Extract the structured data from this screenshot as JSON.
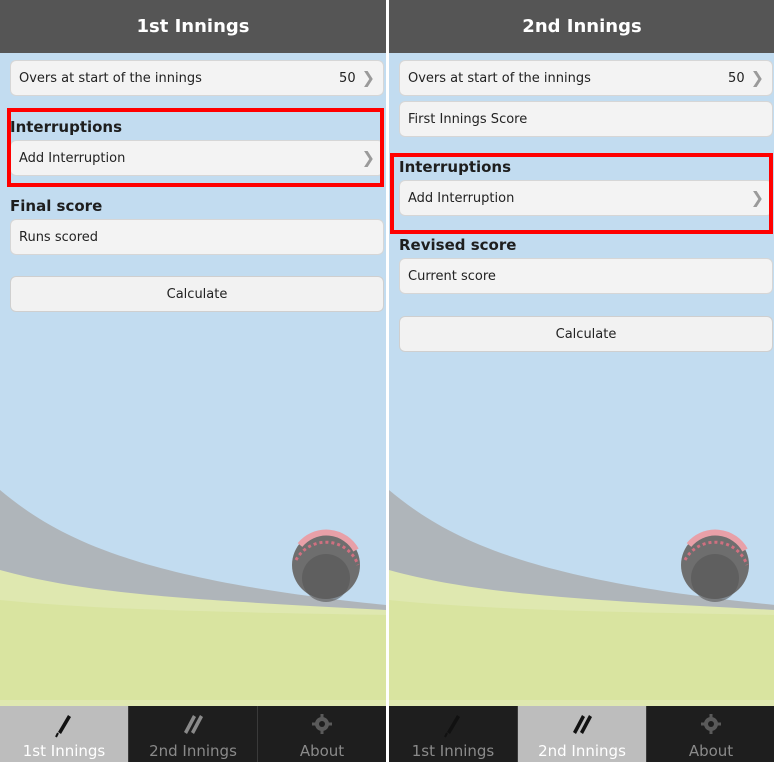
{
  "screens": [
    {
      "title": "1st Innings",
      "overs_label": "Overs at start of the innings",
      "overs_value": "50",
      "interruptions_heading": "Interruptions",
      "add_interruption": "Add Interruption",
      "score_heading": "Final score",
      "score_placeholder": "Runs scored",
      "calculate": "Calculate",
      "active_tab": 0
    },
    {
      "title": "2nd Innings",
      "overs_label": "Overs at start of the innings",
      "overs_value": "50",
      "first_innings_label": "First Innings Score",
      "interruptions_heading": "Interruptions",
      "add_interruption": "Add Interruption",
      "score_heading": "Revised score",
      "score_placeholder": "Current score",
      "calculate": "Calculate",
      "active_tab": 1
    }
  ],
  "tabs": [
    {
      "label": "1st Innings",
      "icon": "bat-icon"
    },
    {
      "label": "2nd Innings",
      "icon": "two-bats-icon"
    },
    {
      "label": "About",
      "icon": "gear-icon"
    }
  ],
  "colors": {
    "sky": "#c2dcf0",
    "header": "#555555",
    "highlight": "#ff0000",
    "tab_active": "#bdbdbd",
    "tab_bg": "#1e1e1e"
  }
}
